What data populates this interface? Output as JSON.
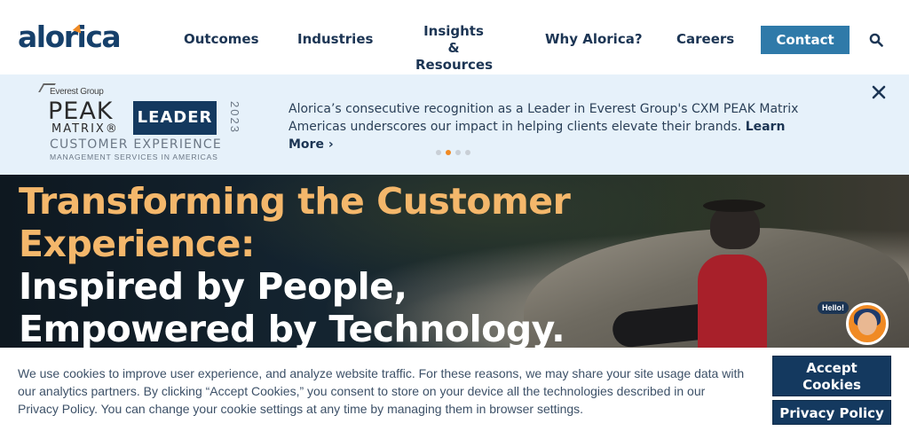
{
  "header": {
    "logo": "alorica",
    "nav": [
      {
        "label": "Outcomes"
      },
      {
        "label": "Industries"
      },
      {
        "label": "Insights &\nResources"
      },
      {
        "label": "Why Alorica?"
      },
      {
        "label": "Careers"
      }
    ],
    "contact_label": "Contact",
    "search_icon": "search-icon"
  },
  "banner": {
    "badge": {
      "org": "Everest Group",
      "peak": "PEAK",
      "matrix": "MATRIX®",
      "leader": "LEADER",
      "year": "2023",
      "category": "CUSTOMER EXPERIENCE",
      "subcategory": "MANAGEMENT SERVICES IN AMERICAS"
    },
    "text": "Alorica’s consecutive recognition as a Leader in Everest Group's CXM PEAK Matrix Americas underscores our impact in helping clients elevate their brands.",
    "learn_more": "Learn More ›",
    "carousel_dots": 4,
    "active_dot": 1,
    "close_icon": "close-icon"
  },
  "hero": {
    "line1": "Transforming the Customer",
    "line2": "Experience:",
    "line3": "Inspired by People,",
    "line4": "Empowered by Technology.",
    "chat_greeting": "Hello!"
  },
  "cookie": {
    "text": "We use cookies to improve user experience, and analyze website traffic. For these reasons, we may share your site usage data with our analytics partners. By clicking “Accept Cookies,” you consent to store on your device all the technologies described in our Privacy Policy. You can change your cookie settings at any time by managing them in browser settings.",
    "accept_label": "Accept\nCookies",
    "privacy_label": "Privacy Policy"
  },
  "colors": {
    "brand_navy": "#14395f",
    "contact_blue": "#2f7aa9",
    "hero_orange": "#f4b76b",
    "banner_bg": "#e6f1fa",
    "accent_orange": "#f08a24"
  }
}
